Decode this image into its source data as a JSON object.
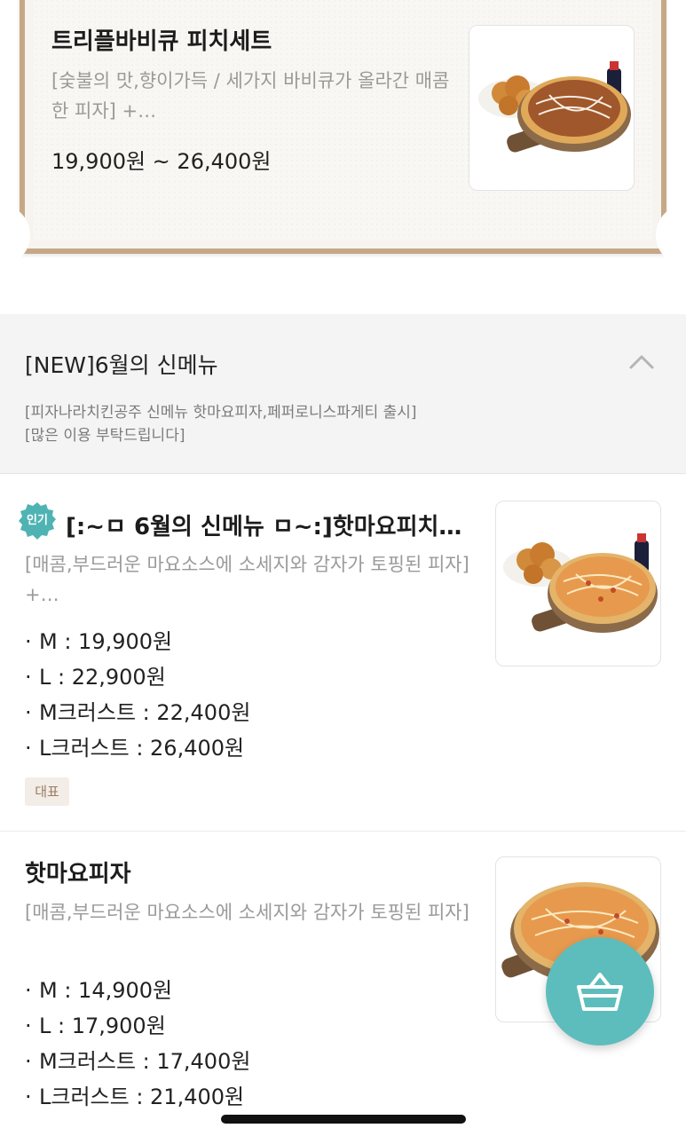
{
  "featured": {
    "title": "트리플바비큐 피치세트",
    "description": "[숯불의 맛,향이가득 / 세가지 바비큐가 올라간 매콤한 피자] +…",
    "price": "19,900원 ~ 26,400원",
    "image_icon": "pizza-set-photo"
  },
  "category": {
    "title": "[NEW]6월의 신메뉴",
    "toggle_icon": "chevron-up-icon",
    "desc_line1": "[피자나라치킨공주 신메뉴 핫마요피자,페퍼로니스파게티 출시]",
    "desc_line2": "[많은 이용 부탁드립니다]"
  },
  "items": [
    {
      "popular_badge": "인기",
      "title": "[:~ㅁ 6월의 신메뉴 ㅁ~:]핫마요피치…",
      "description": "[매콤,부드러운 마요소스에 소세지와 감자가 토핑된 피자] +…",
      "options": [
        {
          "label": "M : 19,900원"
        },
        {
          "label": "L : 22,900원"
        },
        {
          "label": "M크러스트 : 22,400원"
        },
        {
          "label": "L크러스트 : 26,400원"
        }
      ],
      "rep_badge": "대표"
    },
    {
      "title": "핫마요피자",
      "description": "[매콤,부드러운 마요소스에 소세지와 감자가 토핑된 피자]",
      "options": [
        {
          "label": "M : 14,900원"
        },
        {
          "label": "L : 17,900원"
        },
        {
          "label": "M크러스트 : 17,400원"
        },
        {
          "label": "L크러스트 : 21,400원"
        }
      ]
    }
  ],
  "cart": {
    "icon": "shopping-basket-icon"
  },
  "colors": {
    "accent": "#5dbdbd",
    "frame": "#c6a887",
    "badge": "#4fb3b3"
  }
}
